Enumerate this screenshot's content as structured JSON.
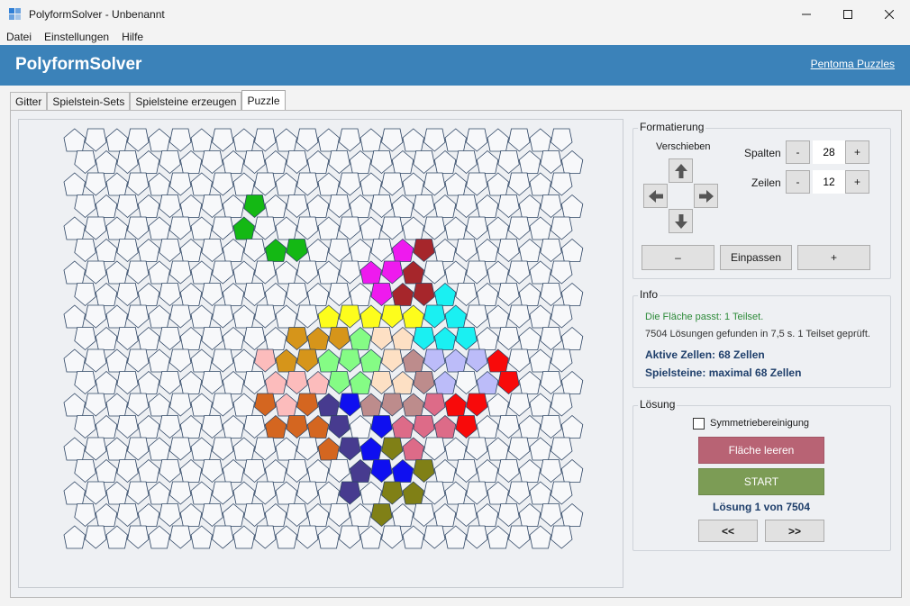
{
  "window": {
    "title": "PolyformSolver - Unbenannt",
    "icon": "app-grid-icon",
    "controls": [
      "minimize-icon",
      "maximize-icon",
      "close-icon"
    ]
  },
  "menu": [
    {
      "label": "Datei"
    },
    {
      "label": "Einstellungen"
    },
    {
      "label": "Hilfe"
    }
  ],
  "header": {
    "title": "PolyformSolver",
    "link": "Pentoma Puzzles",
    "color": "#3b82b9"
  },
  "tabs": [
    {
      "label": "Gitter",
      "active": false
    },
    {
      "label": "Spielstein-Sets",
      "active": false
    },
    {
      "label": "Spielsteine erzeugen",
      "active": false
    },
    {
      "label": "Puzzle",
      "active": true
    }
  ],
  "formatting": {
    "title": "Formatierung",
    "move_label": "Verschieben",
    "arrows": [
      "arrow-up-icon",
      "arrow-left-icon",
      "arrow-right-icon",
      "arrow-down-icon"
    ],
    "columns": {
      "label": "Spalten",
      "value": "28",
      "minus": "-",
      "plus": "+"
    },
    "rows": {
      "label": "Zeilen",
      "value": "12",
      "minus": "-",
      "plus": "+"
    },
    "zoom_out": "–",
    "fit": "Einpassen",
    "zoom_in": "+"
  },
  "info": {
    "title": "Info",
    "fit_message": "Die Fläche passt: 1 Teilset.",
    "solutions_message": "7504 Lösungen gefunden in 7,5 s. 1 Teilset geprüft.",
    "active_cells": "Aktive Zellen: 68 Zellen",
    "pieces": "Spielsteine: maximal 68 Zellen",
    "success_color": "#2e8b3a"
  },
  "solution": {
    "title": "Lösung",
    "symmetry_label": "Symmetriebereinigung",
    "symmetry_checked": false,
    "clear_label": "Fläche leeren",
    "clear_color": "#b86374",
    "start_label": "START",
    "start_color": "#7c9c55",
    "counter": "Lösung 1 von 7504",
    "prev_label": "<<",
    "next_label": ">>"
  },
  "puzzle": {
    "columns": 28,
    "rows": 12,
    "empty_fill": "#f7f8fa",
    "stroke": "#2d4463",
    "pieces": [
      {
        "name": "green",
        "color": "#14b814"
      },
      {
        "name": "magenta",
        "color": "#ee1aee"
      },
      {
        "name": "dark-red",
        "color": "#a6262b"
      },
      {
        "name": "yellow",
        "color": "#fdfd1c"
      },
      {
        "name": "cyan",
        "color": "#1af0f2"
      },
      {
        "name": "ochre",
        "color": "#d6951a"
      },
      {
        "name": "light-green",
        "color": "#85fc85"
      },
      {
        "name": "peach",
        "color": "#fde0c4"
      },
      {
        "name": "mauve",
        "color": "#bd8c8c"
      },
      {
        "name": "lavender",
        "color": "#bcbcf9"
      },
      {
        "name": "red",
        "color": "#f80a0a"
      },
      {
        "name": "pink",
        "color": "#fcbcbc"
      },
      {
        "name": "orange",
        "color": "#d46620"
      },
      {
        "name": "indigo",
        "color": "#473b8f"
      },
      {
        "name": "blue",
        "color": "#0f0ff0"
      },
      {
        "name": "rose",
        "color": "#dd6b88"
      },
      {
        "name": "olive",
        "color": "#808016"
      }
    ]
  }
}
